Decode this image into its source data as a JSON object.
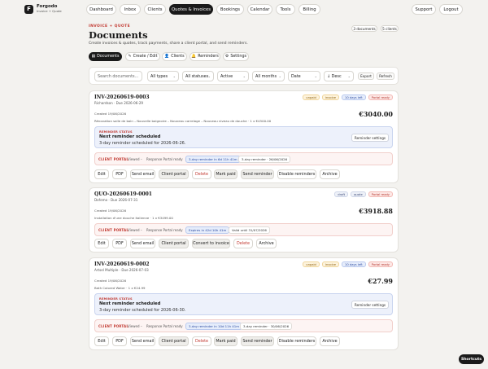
{
  "brand": {
    "logo_letter": "F",
    "name": "Forgodo",
    "sub": "Invoice + Quote"
  },
  "nav": {
    "dashboard": "Dashboard",
    "inbox": "Inbox",
    "clients": "Clients",
    "quotes_invoices": "Quotes & Invoices",
    "bookings": "Bookings",
    "calendar": "Calendar",
    "tools": "Tools",
    "billing": "Billing",
    "support": "Support",
    "logout": "Logout"
  },
  "header": {
    "breadcrumb": "INVOICE + QUOTE",
    "title": "Documents",
    "subtitle": "Create invoices & quotes, track payments, share a client portal, and send reminders.",
    "documents_count": "3 documents",
    "clients_count": "5 clients"
  },
  "tabs": {
    "documents": "Documents",
    "create_edit": "Create / Edit",
    "clients": "Clients",
    "reminders": "Reminders",
    "settings": "Settings"
  },
  "filters": {
    "search_placeholder": "Search documents...",
    "types": "All types",
    "statuses": "All statuses",
    "active": "Active",
    "months": "All months",
    "date": "Date",
    "order": "↓ Desc",
    "export": "Export",
    "refresh": "Refresh"
  },
  "cards": [
    {
      "number": "INV-20260619-0003",
      "meta": "Richardson · Due 2026-06-29",
      "chips": [
        "unpaid",
        "invoice",
        "10 days left",
        "Portal ready"
      ],
      "created": "Created 19/06/2026",
      "amount": "€3040.00",
      "lines": "Rénovation salle de bain – Nouvelle baignoire – Nouveau carrelage – Nouveau niveau de douche · 1 x €4500.00",
      "reminder_label": "REMINDER STATUS",
      "reminder_head": "Next reminder scheduled",
      "reminder_text": "3-day reminder scheduled for 2026-06-26.",
      "reminder_btn": "Reminder settings",
      "portal_label": "CLIENT PORTAL",
      "viewed": "Viewed –",
      "response": "Response Portal ready",
      "portal_pill_1": "3-day reminder in 6d 11h 41m",
      "portal_pill_2": "3-day reminder · 26/06/2026",
      "actions": [
        "Edit",
        "PDF",
        "Send email",
        "Client portal",
        "Delete",
        "Mark paid",
        "Send reminder",
        "Disable reminders",
        "Archive"
      ]
    },
    {
      "number": "QUO-20260619-0001",
      "meta": "Dofemo · Due 2026-07-31",
      "chips": [
        "draft",
        "quote",
        "Portal ready"
      ],
      "created": "Created 19/06/2026",
      "amount": "€3918.88",
      "lines": "Installation d'une douche italienne · 1 x €3499.00",
      "portal_label": "CLIENT PORTAL",
      "viewed": "Viewed –",
      "response": "Response Portal ready",
      "portal_pill_1": "Expires in 42d 10h 41m",
      "portal_pill_2": "Valid until 31/07/2026",
      "actions": [
        "Edit",
        "PDF",
        "Send email",
        "Client portal",
        "Convert to invoice",
        "Delete",
        "Archive"
      ]
    },
    {
      "number": "INV-20260619-0002",
      "meta": "Artsel Multiple · Due 2026-07-03",
      "chips": [
        "unpaid",
        "invoice",
        "10 days left",
        "Portal ready"
      ],
      "created": "Created 19/06/2026",
      "amount": "€27.99",
      "lines": "Bath Colored Water · 1 x €24.99",
      "reminder_label": "REMINDER STATUS",
      "reminder_head": "Next reminder scheduled",
      "reminder_text": "3-day reminder scheduled for 2026-06-30.",
      "reminder_btn": "Reminder settings",
      "portal_label": "CLIENT PORTAL",
      "viewed": "Viewed –",
      "response": "Response Portal ready",
      "portal_pill_1": "3-day reminder in 10d 11h 41m",
      "portal_pill_2": "3-day reminder · 30/06/2026",
      "actions": [
        "Edit",
        "PDF",
        "Send email",
        "Client portal",
        "Delete",
        "Mark paid",
        "Send reminder",
        "Disable reminders",
        "Archive"
      ]
    }
  ],
  "shortcuts": "Shortcuts"
}
